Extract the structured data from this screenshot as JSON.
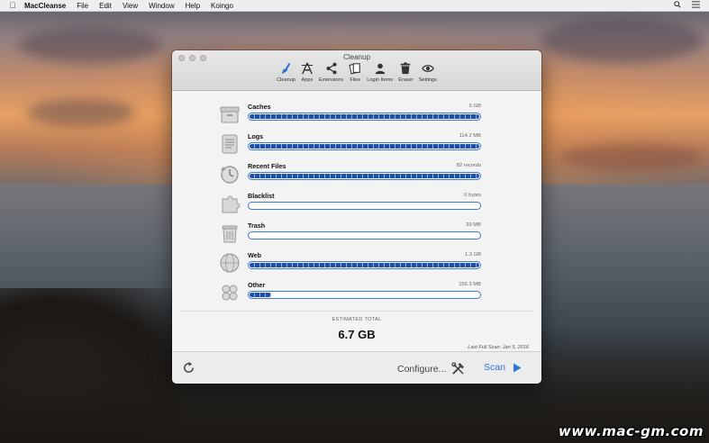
{
  "menubar": {
    "app_name": "MacCleanse",
    "items": [
      "File",
      "Edit",
      "View",
      "Window",
      "Help",
      "Koingo"
    ]
  },
  "window": {
    "title": "Cleanup",
    "toolbar": [
      {
        "label": "Cleanup",
        "icon": "broom-icon",
        "active": true
      },
      {
        "label": "Apps",
        "icon": "apps-icon"
      },
      {
        "label": "Extensions",
        "icon": "share-icon"
      },
      {
        "label": "Files",
        "icon": "files-icon"
      },
      {
        "label": "Login Items",
        "icon": "user-icon"
      },
      {
        "label": "Eraser",
        "icon": "trash-icon"
      },
      {
        "label": "Settings",
        "icon": "eye-icon"
      }
    ]
  },
  "categories": [
    {
      "label": "Caches",
      "size": "5 GB",
      "fill": 1.0,
      "icon": "box-icon"
    },
    {
      "label": "Logs",
      "size": "114.2 MB",
      "fill": 1.0,
      "icon": "log-icon"
    },
    {
      "label": "Recent Files",
      "size": "82 records",
      "fill": 1.0,
      "icon": "clock-icon"
    },
    {
      "label": "Blacklist",
      "size": "0 bytes",
      "fill": 0.0,
      "icon": "puzzle-icon"
    },
    {
      "label": "Trash",
      "size": "39 MB",
      "fill": 0.0,
      "icon": "trash-can-icon"
    },
    {
      "label": "Web",
      "size": "1.3 GB",
      "fill": 1.0,
      "icon": "globe-icon"
    },
    {
      "label": "Other",
      "size": "156.3 MB",
      "fill": 0.1,
      "icon": "grid-icon"
    }
  ],
  "summary": {
    "label": "ESTIMATED TOTAL",
    "value": "6.7 GB",
    "last_scan": "Last Full Scan: Jan 5, 2016"
  },
  "footer": {
    "configure_label": "Configure...",
    "scan_label": "Scan"
  },
  "colors": {
    "accent": "#2e74d8",
    "bar_fill": "#1f4fa6"
  },
  "watermark": "www.mac-gm.com"
}
